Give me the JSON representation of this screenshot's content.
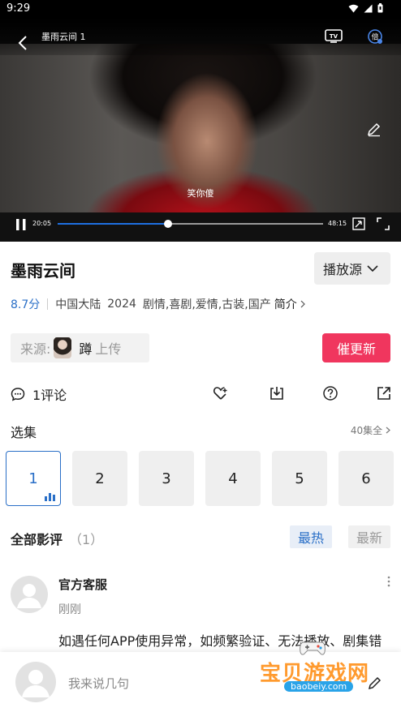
{
  "status_bar": {
    "time": "9:29"
  },
  "player": {
    "title": "墨雨云间 1",
    "subtitle": "笑你傻",
    "current_time": "20:05",
    "total_time": "48:15",
    "progress": 0.415,
    "tv_label": "TV",
    "speed_label": "倍"
  },
  "show": {
    "title": "墨雨云间",
    "source_label": "播放源",
    "score": "8.7分",
    "region": "中国大陆",
    "year": "2024",
    "genres": "剧情,喜剧,爱情,古装,国产",
    "intro_label": "简介"
  },
  "uploader": {
    "label": "来源:",
    "name": "蹲",
    "action": "上传"
  },
  "update_button": "催更新",
  "comments_count": "1评论",
  "episodes": {
    "heading": "选集",
    "all_label": "40集全",
    "items": [
      "1",
      "2",
      "3",
      "4",
      "5",
      "6"
    ],
    "active": "1"
  },
  "reviews": {
    "heading": "全部影评",
    "count": "（1）",
    "tab_hot": "最热",
    "tab_new": "最新"
  },
  "comment": {
    "author": "官方客服",
    "time": "刚刚",
    "text": "如遇任何APP使用异常，如频繁验证、无法播放、剧集错乱等，请先尝试重启，如还无法解决，请连"
  },
  "bottom": {
    "placeholder": "我来说几句"
  },
  "watermark": {
    "text": "宝贝游戏网",
    "url": "baobeiy.com"
  },
  "colors": {
    "accent": "#2a6fc7",
    "update": "#f0365e",
    "progress": "#1e6fe0"
  }
}
